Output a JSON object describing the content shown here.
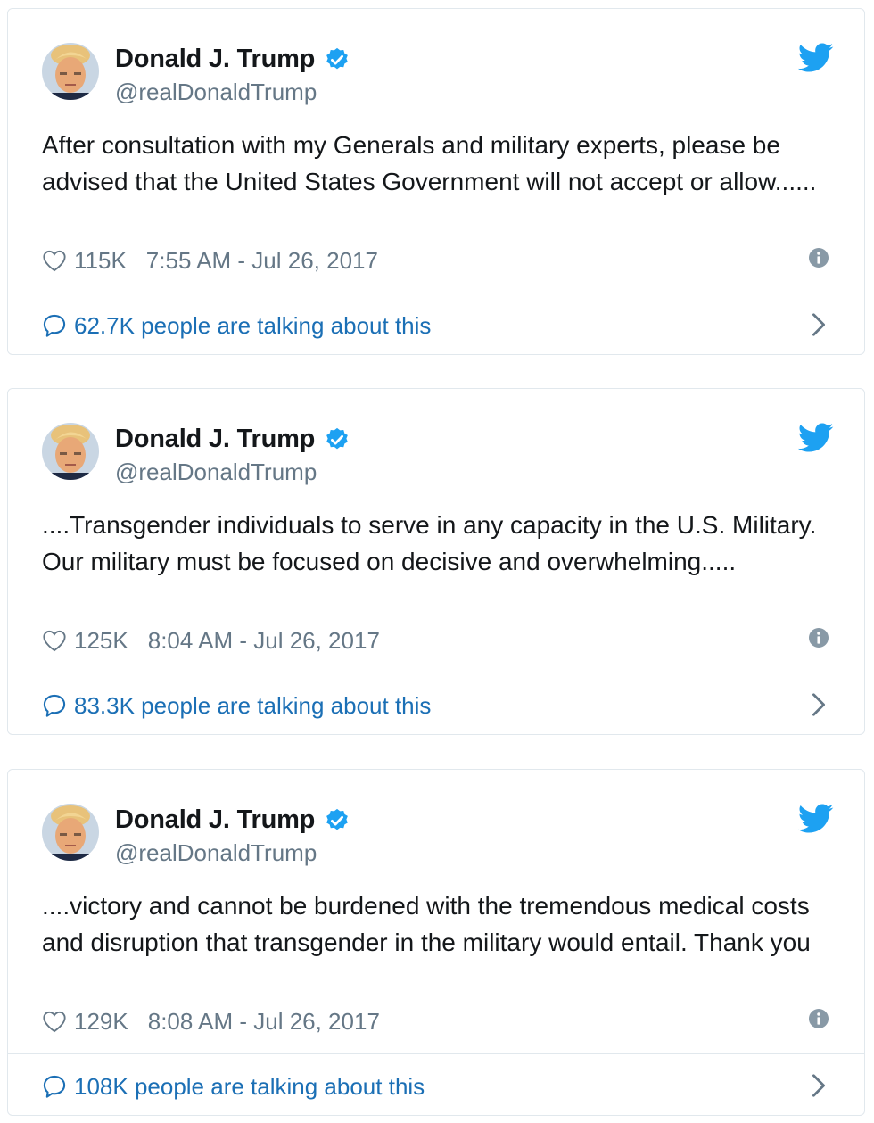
{
  "colors": {
    "text": "#14171a",
    "secondary": "#657786",
    "link": "#1b6fb5",
    "verified": "#1da1f2",
    "border": "#e1e8ed"
  },
  "tweets": [
    {
      "name": "Donald J. Trump",
      "handle": "@realDonaldTrump",
      "text": "After consultation with my Generals and military experts, please be advised that the United States Government will not accept or allow......",
      "likes": "115K",
      "timestamp": "7:55 AM - Jul 26, 2017",
      "talking": "62.7K people are talking about this"
    },
    {
      "name": "Donald J. Trump",
      "handle": "@realDonaldTrump",
      "text": "....Transgender individuals to  serve in any capacity in the U.S. Military. Our military must be focused on decisive and overwhelming.....",
      "likes": "125K",
      "timestamp": "8:04 AM - Jul 26, 2017",
      "talking": "83.3K people are talking about this"
    },
    {
      "name": "Donald J. Trump",
      "handle": "@realDonaldTrump",
      "text": "....victory and cannot be burdened with the tremendous medical costs and disruption that transgender in the military would entail. Thank you",
      "likes": "129K",
      "timestamp": "8:08 AM - Jul 26, 2017",
      "talking": "108K people are talking about this"
    }
  ]
}
